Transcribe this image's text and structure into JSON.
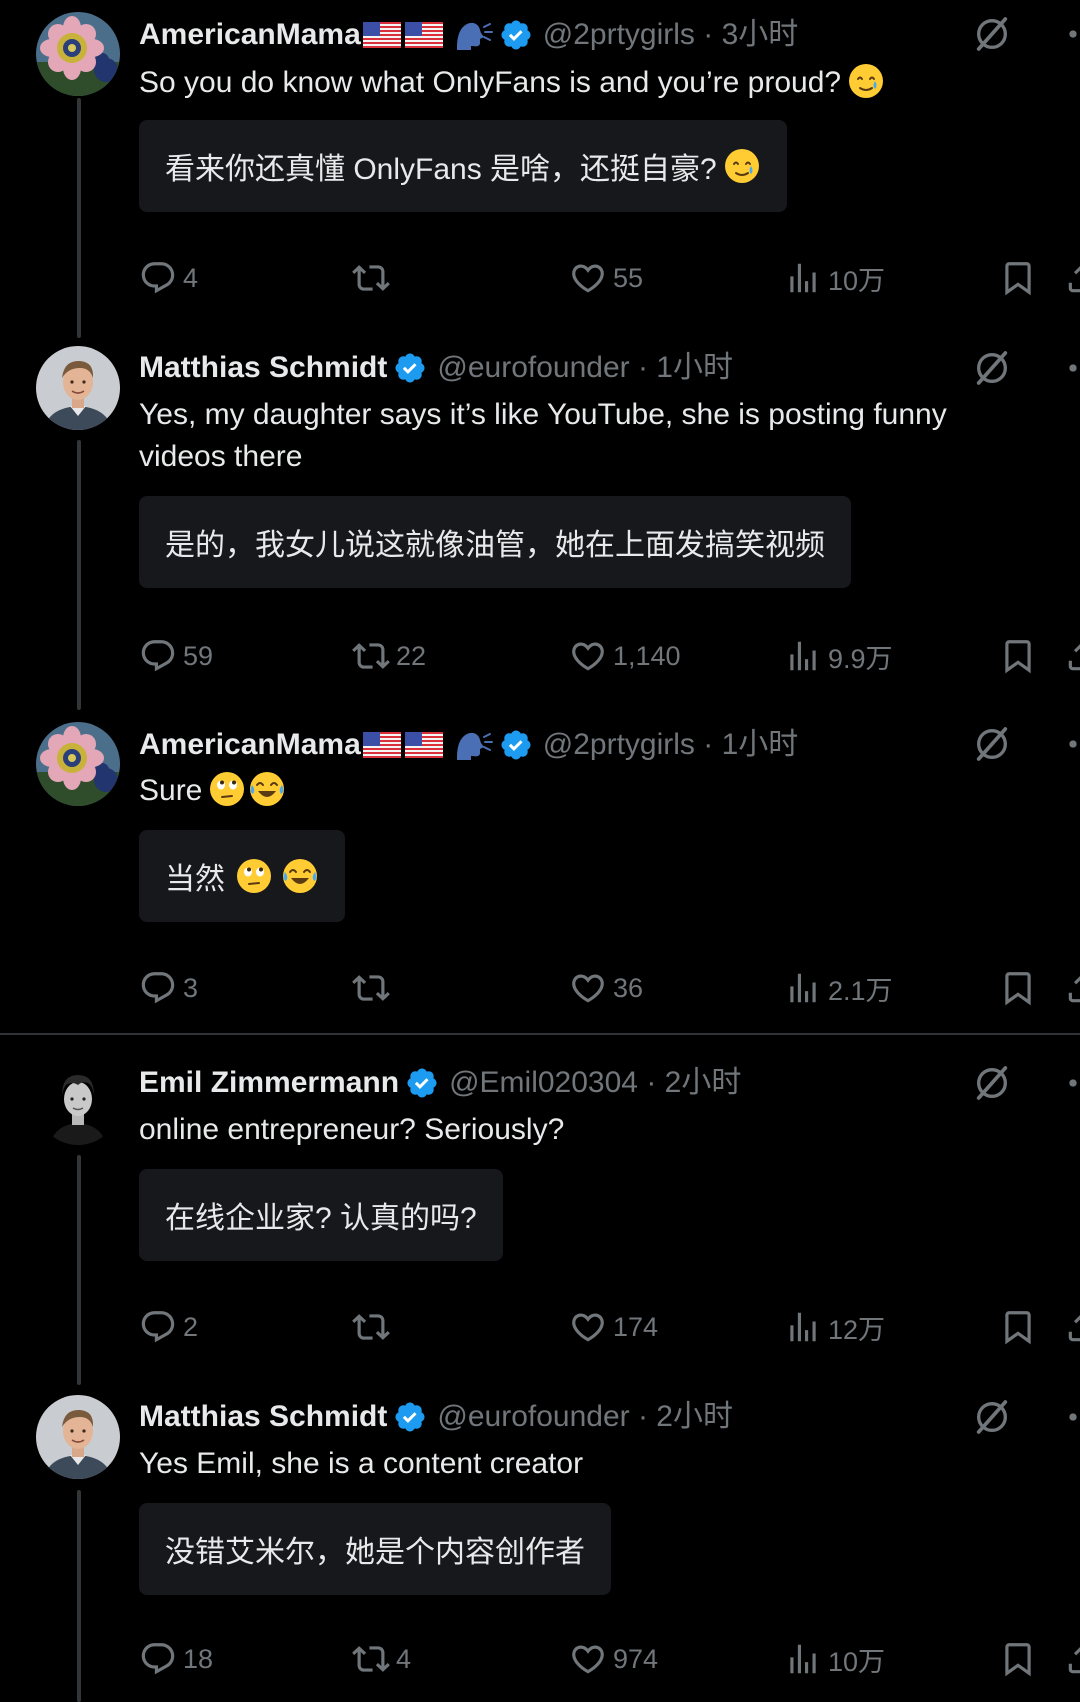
{
  "tweets": [
    {
      "name": "AmericanMama",
      "handle": "@2prtygirls",
      "time": "3小时",
      "text": "So you do know what OnlyFans is and you’re proud?",
      "translation": "看来你还真懂 OnlyFans 是啥，还挺自豪?",
      "replies": "4",
      "retweets": "",
      "likes": "55",
      "views": "10万"
    },
    {
      "name": "Matthias Schmidt",
      "handle": "@eurofounder",
      "time": "1小时",
      "text": "Yes, my daughter says it’s like YouTube, she is posting funny videos there",
      "translation": "是的，我女儿说这就像油管，她在上面发搞笑视频",
      "replies": "59",
      "retweets": "22",
      "likes": "1,140",
      "views": "9.9万"
    },
    {
      "name": "AmericanMama",
      "handle": "@2prtygirls",
      "time": "1小时",
      "text": "Sure",
      "translation": "当然",
      "replies": "3",
      "retweets": "",
      "likes": "36",
      "views": "2.1万"
    },
    {
      "name": "Emil Zimmermann",
      "handle": "@Emil020304",
      "time": "2小时",
      "text": "online entrepreneur? Seriously?",
      "translation": "在线企业家? 认真的吗?",
      "replies": "2",
      "retweets": "",
      "likes": "174",
      "views": "12万"
    },
    {
      "name": "Matthias Schmidt",
      "handle": "@eurofounder",
      "time": "2小时",
      "text": "Yes Emil, she is a content creator",
      "translation": "没错艾米尔，她是个内容创作者",
      "replies": "18",
      "retweets": "4",
      "likes": "974",
      "views": "10万"
    }
  ],
  "meta_separator": " · ",
  "colors": {
    "background": "#000000",
    "text_primary": "#e7e9ea",
    "text_secondary": "#71767b",
    "verified": "#1d9bf0",
    "translation_box": "#16181c",
    "thread_line": "#333639"
  },
  "icons": [
    "reply-icon",
    "retweet-icon",
    "like-icon",
    "views-icon",
    "bookmark-icon",
    "share-icon",
    "grok-icon",
    "more-icon",
    "verified-icon",
    "speak-icon",
    "us-flag-icon"
  ]
}
